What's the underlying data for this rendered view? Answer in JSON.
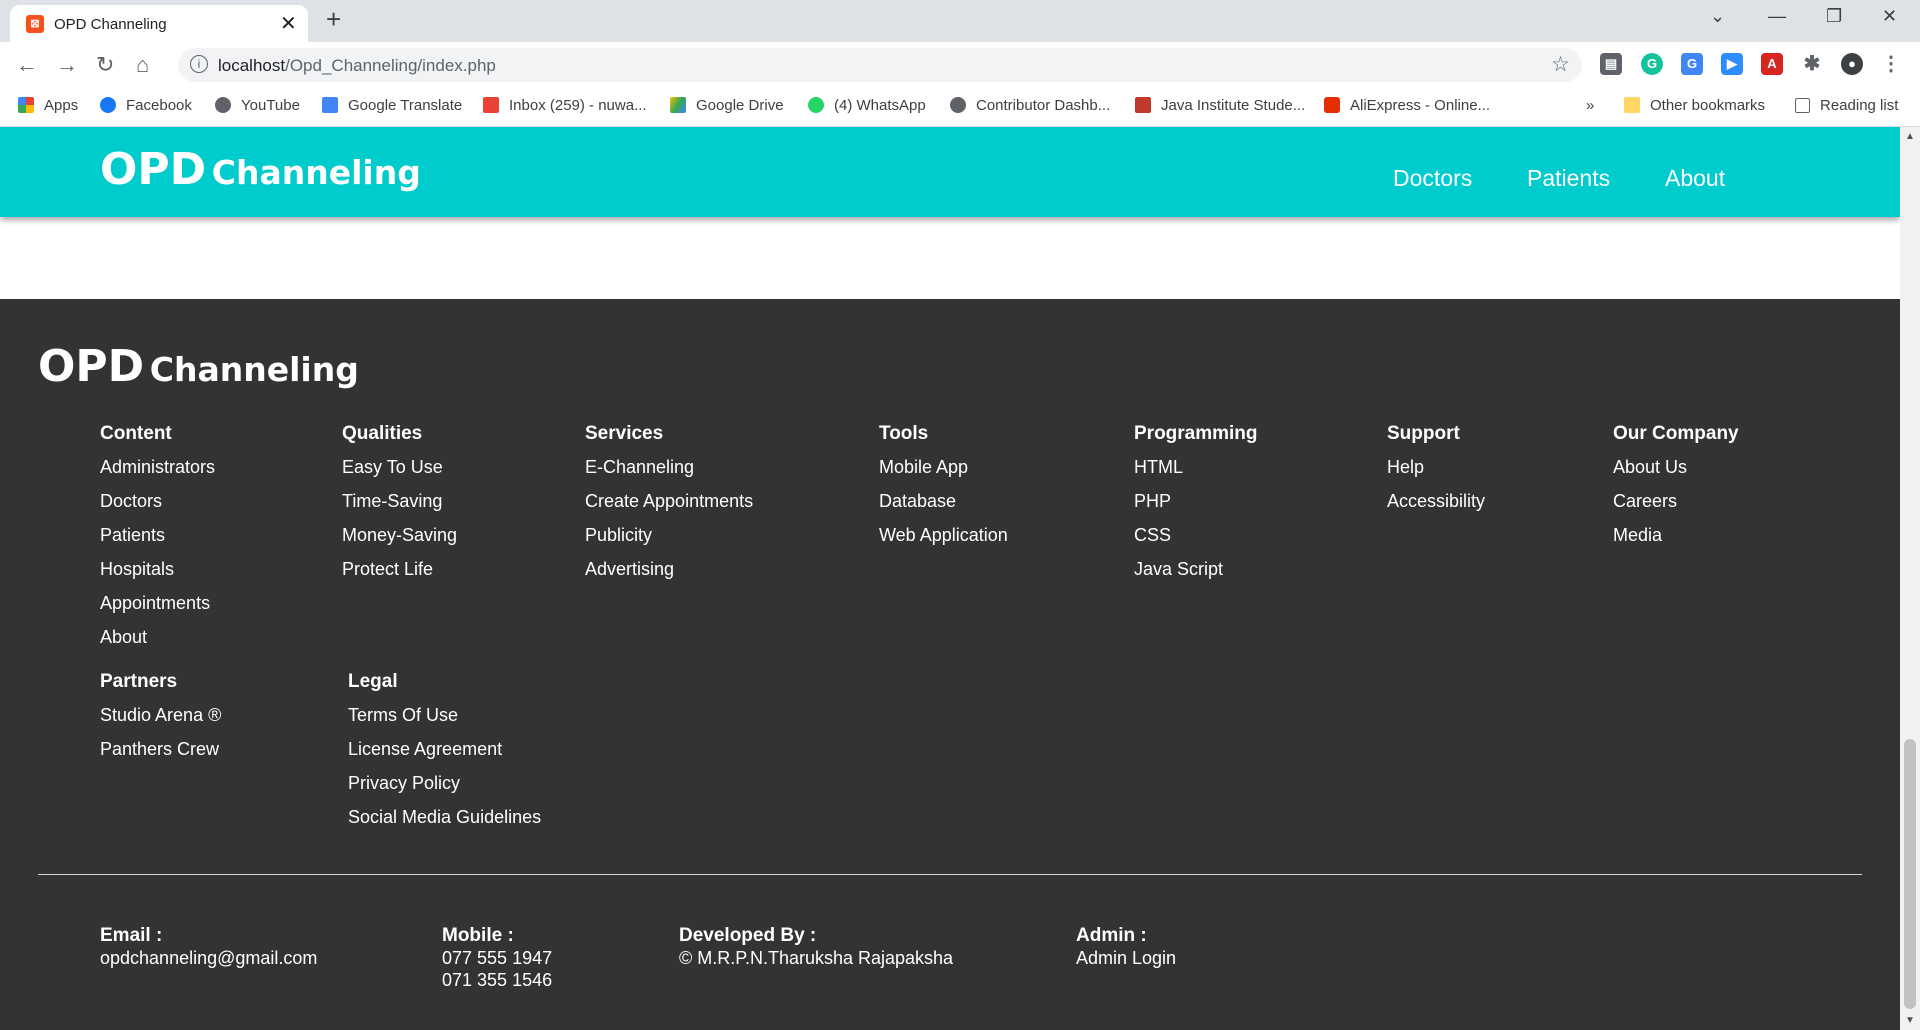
{
  "browser": {
    "tab_title": "OPD Channeling",
    "url_host": "localhost",
    "url_path": "/Opd_Channeling/index.php",
    "bookmarks": [
      "Apps",
      "Facebook",
      "YouTube",
      "Google Translate",
      "Inbox (259) - nuwa...",
      "Google Drive",
      "(4) WhatsApp",
      "Contributor Dashb...",
      "Java Institute Stude...",
      "AliExpress - Online..."
    ],
    "overflow_label": "»",
    "other_bookmarks": "Other bookmarks",
    "reading_list": "Reading list"
  },
  "navbar": {
    "brand_big": "OPD",
    "brand_small": "Channeling",
    "links": [
      "Doctors",
      "Patients",
      "About"
    ],
    "color": "#00cccd"
  },
  "footer": {
    "brand_big": "OPD",
    "brand_small": "Channeling",
    "background": "#333333",
    "columns": [
      {
        "heading": "Content",
        "links": [
          "Administrators",
          "Doctors",
          "Patients",
          "Hospitals",
          "Appointments",
          "About"
        ]
      },
      {
        "heading": "Qualities",
        "links": [
          "Easy To Use",
          "Time-Saving",
          "Money-Saving",
          "Protect Life"
        ]
      },
      {
        "heading": "Services",
        "links": [
          "E-Channeling",
          "Create Appointments",
          "Publicity",
          "Advertising"
        ]
      },
      {
        "heading": "Tools",
        "links": [
          "Mobile App",
          "Database",
          "Web Application"
        ]
      },
      {
        "heading": "Programming",
        "links": [
          "HTML",
          "PHP",
          "CSS",
          "Java Script"
        ]
      },
      {
        "heading": "Support",
        "links": [
          "Help",
          "Accessibility"
        ]
      },
      {
        "heading": "Our Company",
        "links": [
          "About Us",
          "Careers",
          "Media"
        ]
      },
      {
        "heading": "Partners",
        "links": [
          "Studio Arena ®",
          "Panthers Crew"
        ]
      },
      {
        "heading": "Legal",
        "links": [
          "Terms Of Use",
          "License Agreement",
          "Privacy Policy",
          "Social Media Guidelines"
        ]
      }
    ],
    "contact": {
      "email_label": "Email :",
      "email": "opdchanneling@gmail.com",
      "mobile_label": "Mobile :",
      "mobile_1": "077 555 1947",
      "mobile_2": "071 355 1546",
      "dev_label": "Developed By :",
      "dev": "© M.R.P.N.Tharuksha Rajapaksha",
      "admin_label": "Admin :",
      "admin_link": "Admin Login"
    }
  }
}
